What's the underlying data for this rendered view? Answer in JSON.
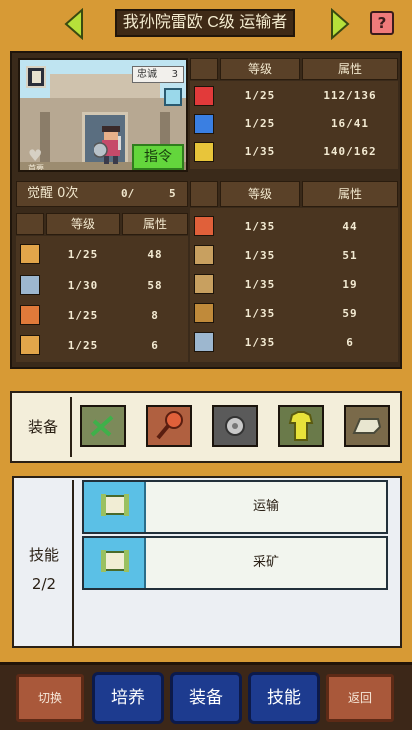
{
  "header": {
    "title": "我孙院雷欧 C级 运输者",
    "help_label": "?"
  },
  "portrait": {
    "loyalty_label": "忠诚",
    "loyalty_value": "3",
    "heart_caption": "首要",
    "command_label": "指令"
  },
  "vitals": {
    "col_level": "等级",
    "col_attr": "属性",
    "rows": [
      {
        "icon": "heart-icon",
        "level": "1/25",
        "attr": "112/136",
        "color": "#e23a3a"
      },
      {
        "icon": "potion-icon",
        "level": "1/25",
        "attr": "16/41",
        "color": "#3a7fe2"
      },
      {
        "icon": "boot-icon",
        "level": "1/35",
        "attr": "140/162",
        "color": "#e8c53a"
      }
    ]
  },
  "awakening": {
    "label": "觉醒 0次",
    "count": "0/",
    "max": "5"
  },
  "combat": {
    "col_level": "等级",
    "col_attr": "属性",
    "rows": [
      {
        "icon": "sword-icon",
        "level": "1/25",
        "attr": "48",
        "color": "#e2a54a"
      },
      {
        "icon": "shield-icon",
        "level": "1/30",
        "attr": "58",
        "color": "#9db7cf"
      },
      {
        "icon": "swap-icon",
        "level": "1/25",
        "attr": "8",
        "color": "#e07a3a"
      },
      {
        "icon": "star-icon",
        "level": "1/25",
        "attr": "6",
        "color": "#e2a54a"
      }
    ]
  },
  "work": {
    "col_level": "等级",
    "col_attr": "属性",
    "rows": [
      {
        "icon": "crate-icon",
        "level": "1/35",
        "attr": "44",
        "color": "#e0603a"
      },
      {
        "icon": "pickaxe-icon",
        "level": "1/35",
        "attr": "51",
        "color": "#c8a060"
      },
      {
        "icon": "shovel-icon",
        "level": "1/35",
        "attr": "19",
        "color": "#c8a060"
      },
      {
        "icon": "basket-icon",
        "level": "1/35",
        "attr": "59",
        "color": "#c08a3a"
      },
      {
        "icon": "watering-can-icon",
        "level": "1/35",
        "attr": "6",
        "color": "#9db7cf"
      }
    ]
  },
  "equipment": {
    "label": "装备",
    "slots": [
      {
        "icon": "bow-icon",
        "bg": "#7c8a5a"
      },
      {
        "icon": "racket-icon",
        "bg": "#b06040"
      },
      {
        "icon": "gear-icon",
        "bg": "#5a5a5a"
      },
      {
        "icon": "shirt-icon",
        "bg": "#6a7a4a"
      },
      {
        "icon": "boots-icon",
        "bg": "#7a6a4a"
      }
    ]
  },
  "skills": {
    "label": "技能",
    "count": "2/2",
    "items": [
      {
        "icon": "scroll-icon",
        "name": "运输"
      },
      {
        "icon": "scroll-icon",
        "name": "采矿"
      }
    ]
  },
  "bottom": {
    "switch": "切换",
    "train": "培养",
    "equip": "装备",
    "skill": "技能",
    "back": "返回"
  }
}
